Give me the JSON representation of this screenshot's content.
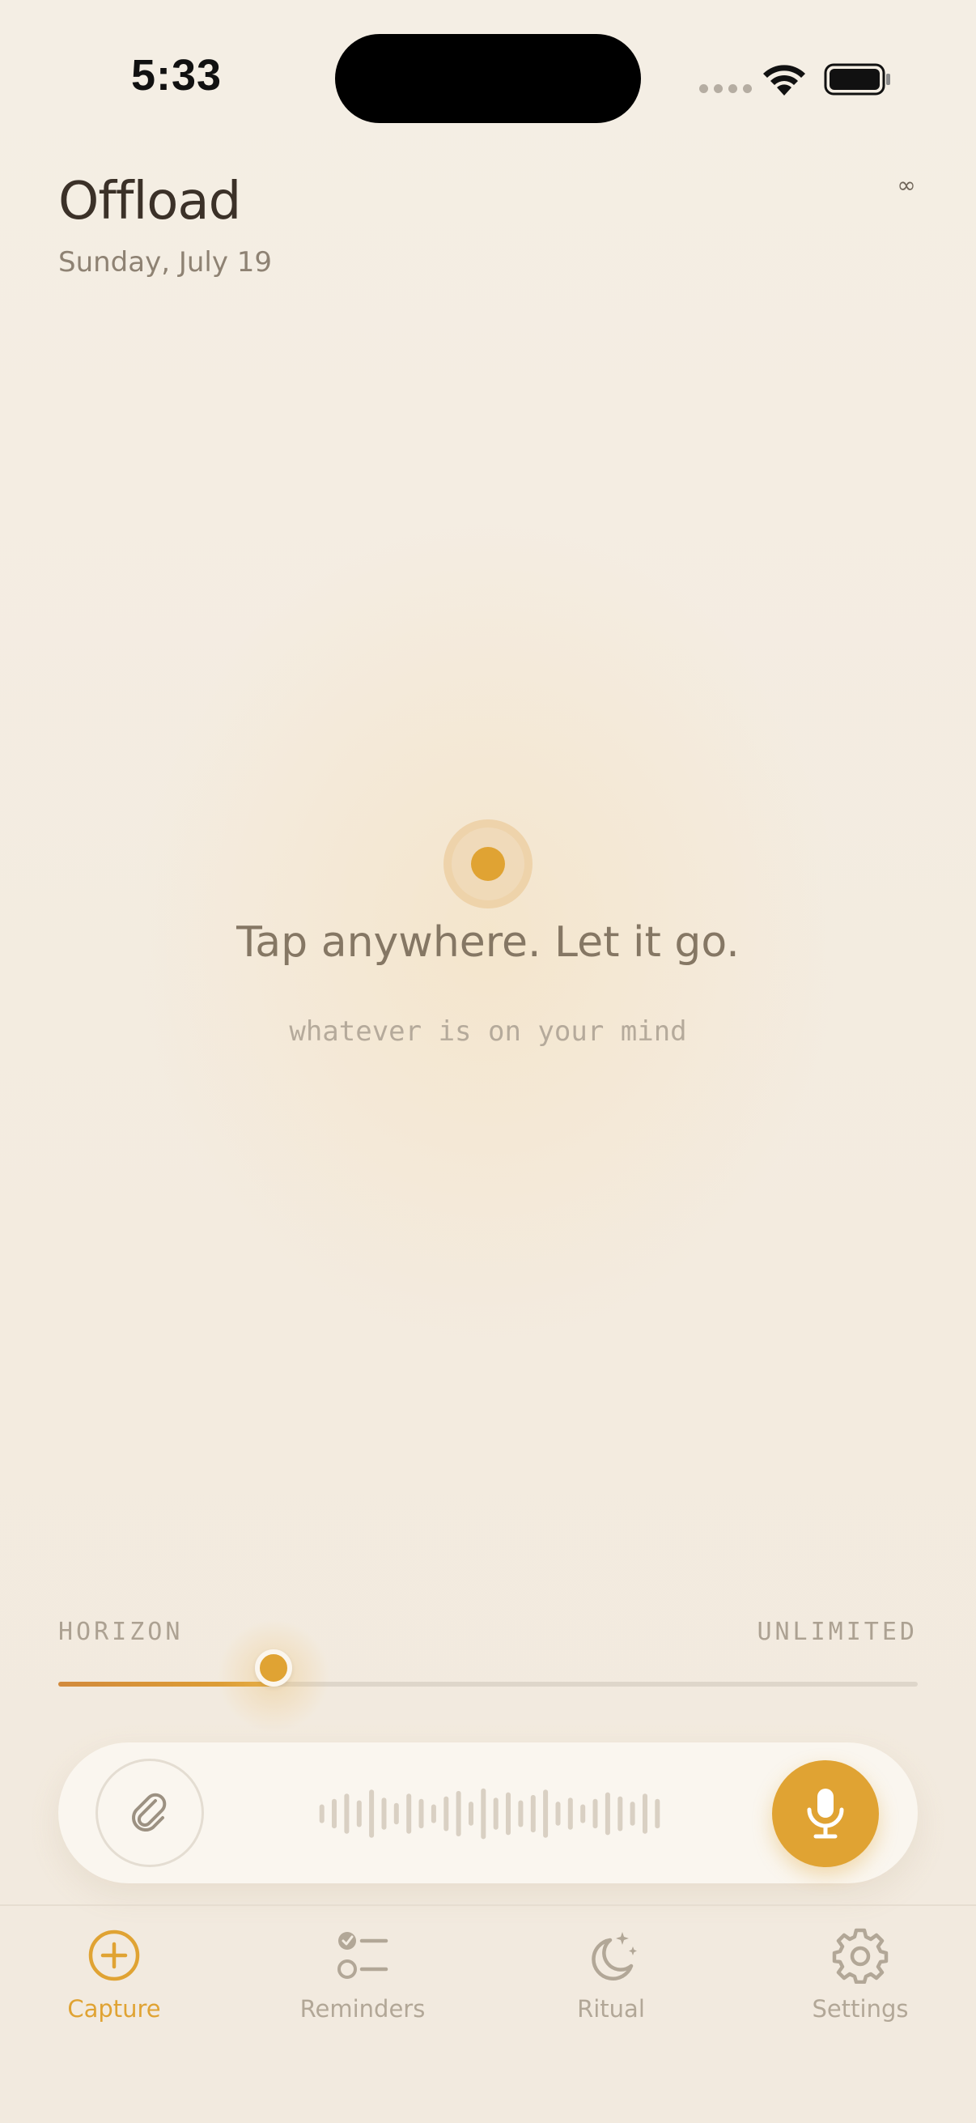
{
  "status_bar": {
    "time": "5:33"
  },
  "header": {
    "title": "Offload",
    "date": "Sunday, July 19",
    "badge": "∞"
  },
  "prompt": {
    "title": "Tap anywhere. Let it go.",
    "subtitle": "whatever is on your mind"
  },
  "horizon": {
    "label": "HORIZON",
    "value_label": "UNLIMITED",
    "position": 0.25
  },
  "capture_bar": {
    "attach_icon": "paperclip-icon",
    "mic_icon": "microphone-icon",
    "waveform_levels": [
      0.35,
      0.55,
      0.75,
      0.5,
      0.9,
      0.6,
      0.4,
      0.75,
      0.55,
      0.35,
      0.65,
      0.85,
      0.45,
      0.95,
      0.6,
      0.8,
      0.5,
      0.7,
      0.9,
      0.45,
      0.6,
      0.35,
      0.55,
      0.8,
      0.65,
      0.45,
      0.75,
      0.55
    ]
  },
  "tabs": [
    {
      "label": "Capture",
      "icon": "plus-circle-icon",
      "active": true
    },
    {
      "label": "Reminders",
      "icon": "checklist-icon",
      "active": false
    },
    {
      "label": "Ritual",
      "icon": "moon-stars-icon",
      "active": false
    },
    {
      "label": "Settings",
      "icon": "gear-icon",
      "active": false
    }
  ],
  "colors": {
    "accent": "#e0a333",
    "background": "#f3ece1",
    "inactive_tab": "#b2a797",
    "title_text": "#3b3128"
  }
}
